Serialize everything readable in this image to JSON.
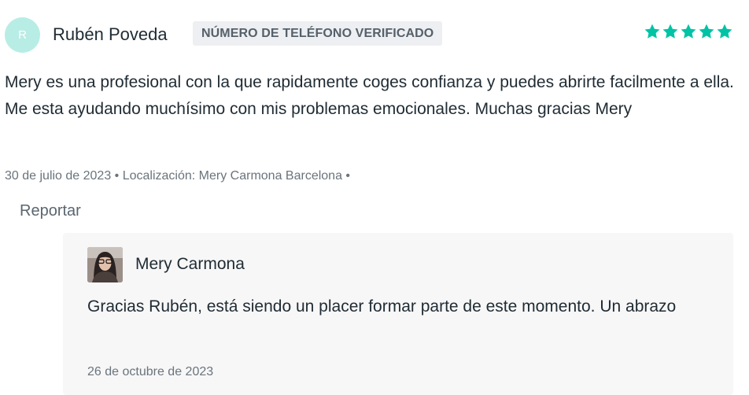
{
  "review": {
    "author_initial": "R",
    "author_name": "Rubén Poveda",
    "verified_badge": "NÚMERO DE TELÉFONO VERIFICADO",
    "rating": 5,
    "rating_max": 5,
    "star_color": "#00c3a5",
    "text": "Mery es una profesional con la que rapidamente coges confianza y puedes abrirte facilmente a ella. Me esta ayudando muchísimo con mis problemas emocionales. Muchas gracias Mery",
    "meta": "30 de julio de 2023 • Localización: Mery Carmona Barcelona •",
    "report_label": "Reportar"
  },
  "reply": {
    "author_name": "Mery Carmona",
    "text": "Gracias Rubén, está siendo un placer formar parte de este momento. Un abrazo",
    "date": "26 de octubre de 2023"
  }
}
